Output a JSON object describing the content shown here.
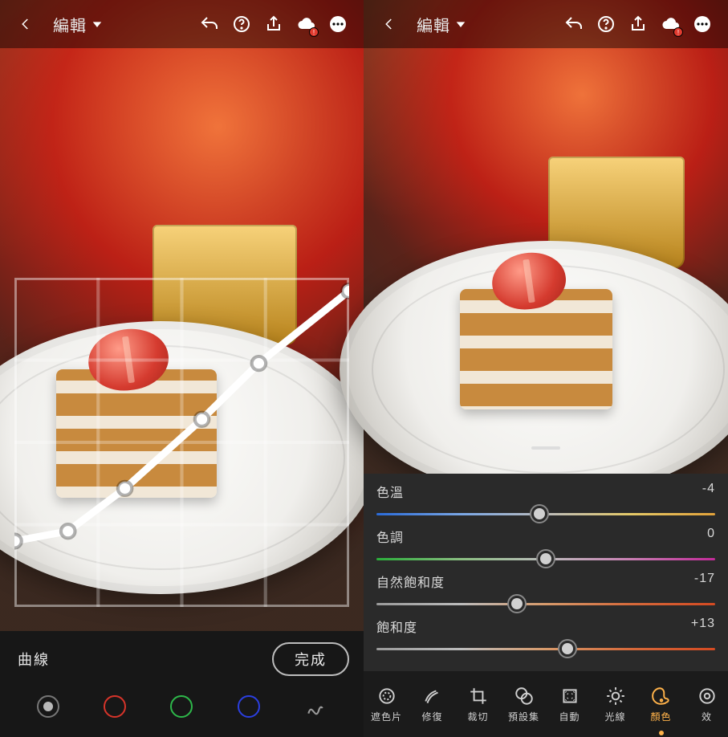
{
  "left": {
    "title": "編輯",
    "curve_label": "曲線",
    "done_label": "完成",
    "channels": {
      "gray": "#b8b8b8",
      "red": "#d7342a",
      "green": "#2eb84a",
      "blue": "#2b3fe0"
    },
    "curve_points": [
      {
        "x": 0.0,
        "y": 0.2
      },
      {
        "x": 0.16,
        "y": 0.23
      },
      {
        "x": 0.33,
        "y": 0.36
      },
      {
        "x": 0.56,
        "y": 0.57
      },
      {
        "x": 0.73,
        "y": 0.74
      },
      {
        "x": 1.0,
        "y": 0.96
      }
    ]
  },
  "right": {
    "title": "編輯",
    "sliders": [
      {
        "key": "temperature",
        "label": "色溫",
        "value": -4,
        "pos": 0.48,
        "gradient": "g-temp"
      },
      {
        "key": "tint",
        "label": "色調",
        "value": 0,
        "pos": 0.5,
        "gradient": "g-tint"
      },
      {
        "key": "vibrance",
        "label": "自然飽和度",
        "value": -17,
        "pos": 0.415,
        "gradient": "g-vib"
      },
      {
        "key": "saturation",
        "label": "飽和度",
        "value": 13,
        "pos": 0.565,
        "gradient": "g-sat"
      }
    ],
    "tools_left": [
      {
        "key": "mask",
        "label": "遮色片"
      },
      {
        "key": "heal",
        "label": "修復"
      },
      {
        "key": "crop",
        "label": "裁切"
      },
      {
        "key": "preset",
        "label": "預設集"
      }
    ],
    "tools_right": [
      {
        "key": "auto",
        "label": "自動",
        "selected": false
      },
      {
        "key": "light",
        "label": "光線",
        "selected": false
      },
      {
        "key": "color",
        "label": "顏色",
        "selected": true
      },
      {
        "key": "effect",
        "label": "效",
        "selected": false
      }
    ]
  }
}
